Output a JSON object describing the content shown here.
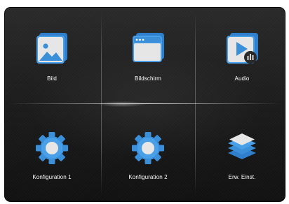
{
  "menu": {
    "items": [
      {
        "label": "Bild",
        "icon": "image-icon"
      },
      {
        "label": "Bildschirm",
        "icon": "screen-window-icon"
      },
      {
        "label": "Audio",
        "icon": "audio-play-icon"
      },
      {
        "label": "Konfiguration 1",
        "icon": "gear-icon"
      },
      {
        "label": "Konfiguration 2",
        "icon": "gear-icon"
      },
      {
        "label": "Erw. Einst.",
        "icon": "layers-icon"
      }
    ]
  },
  "colors": {
    "panel_background": "#1c1c1c",
    "icon_blue": "#3b8fd9",
    "icon_gray": "#d8d8d8",
    "label_text": "#ffffff"
  }
}
